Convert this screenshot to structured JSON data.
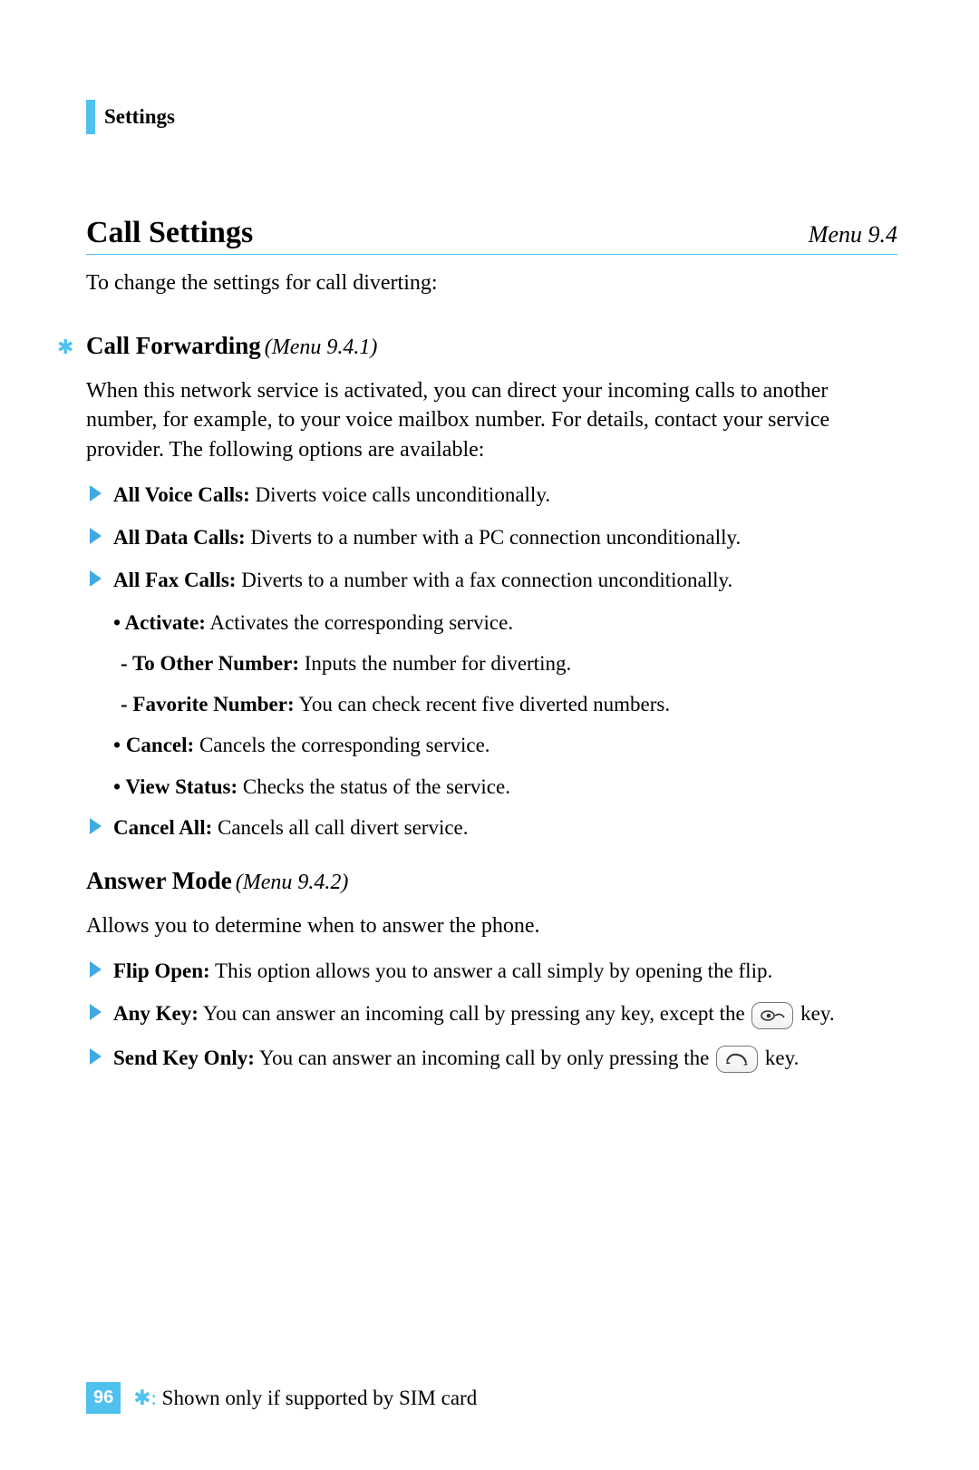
{
  "header": {
    "chapter": "Settings"
  },
  "title": {
    "main": "Call Settings",
    "menu": "Menu 9.4"
  },
  "intro": "To change the settings for call diverting:",
  "section1": {
    "asterisk": "✱",
    "title": "Call Forwarding",
    "menu": "(Menu 9.4.1)",
    "desc": "When this network service is activated, you can direct your incoming calls to another number, for example, to your voice mailbox number. For details, contact your service provider. The following options are available:",
    "items": [
      {
        "label": "All Voice Calls:",
        "text": " Diverts voice calls unconditionally."
      },
      {
        "label": "All Data Calls:",
        "text": " Diverts to a number with a PC connection unconditionally."
      },
      {
        "label": "All Fax Calls:",
        "text": " Diverts to a number with a fax connection unconditionally."
      }
    ],
    "sub": [
      {
        "label": "Activate:",
        "text": " Activates the corresponding service."
      }
    ],
    "sub2": [
      {
        "label": "To Other Number:",
        "text": " Inputs the number for diverting."
      },
      {
        "label": "Favorite Number:",
        "text": " You can check recent five diverted numbers."
      }
    ],
    "sub_after": [
      {
        "label": "Cancel:",
        "text": " Cancels the corresponding service."
      },
      {
        "label": "View Status:",
        "text": " Checks the status of the service."
      }
    ],
    "items_after": [
      {
        "label": "Cancel All:",
        "text": " Cancels all call divert service."
      }
    ]
  },
  "section2": {
    "title": "Answer Mode",
    "menu": "(Menu 9.4.2)",
    "desc": "Allows you to determine when to answer the phone.",
    "items": [
      {
        "label": "Flip Open:",
        "text": " This option allows you to answer a call simply by opening the flip."
      },
      {
        "label": "Any Key:",
        "pre": " You can answer an incoming call by pressing any key, except the ",
        "post": " key."
      },
      {
        "label": "Send Key Only:",
        "pre": " You can answer an incoming call by only pressing the ",
        "post": " key."
      }
    ]
  },
  "footer": {
    "page": "96",
    "asterisk": "✱:",
    "note": " Shown only if supported by SIM card"
  }
}
